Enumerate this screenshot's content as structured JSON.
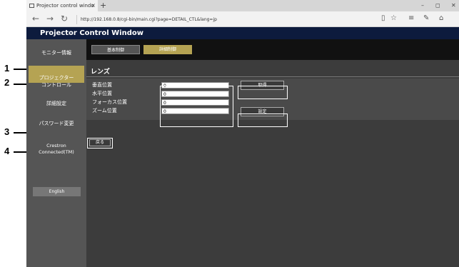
{
  "browser": {
    "tab_title": "Projector control windo",
    "tab_close": "×",
    "new_tab": "+",
    "url": "http://192.168.0.8/cgi-bin/main.cgi?page=DETAIL_CTL&lang=jp",
    "nav": {
      "back": "←",
      "forward": "→",
      "refresh": "↻"
    },
    "tools": {
      "reading": "▯",
      "favorite": "☆",
      "hub": "≡",
      "notes": "✎",
      "share": "⌂"
    },
    "window": {
      "minimize": "–",
      "maximize": "◻",
      "close": "✕"
    }
  },
  "app": {
    "title": "Projector Control Window"
  },
  "sidebar": {
    "items": [
      {
        "label": "モニター情報"
      },
      {
        "label": "プロジェクター\nコントロール"
      },
      {
        "label": "詳細設定"
      },
      {
        "label": "パスワード変更"
      },
      {
        "label": "Crestron\nConnected(TM)"
      }
    ],
    "english_label": "English"
  },
  "top_tabs": [
    {
      "label": "基本制御"
    },
    {
      "label": "詳細制御"
    }
  ],
  "section": {
    "title": "レンズ",
    "rows": [
      {
        "label": "垂直位置",
        "value": "0"
      },
      {
        "label": "水平位置",
        "value": "0"
      },
      {
        "label": "フォーカス位置",
        "value": "0"
      },
      {
        "label": "ズーム位置",
        "value": "0"
      }
    ],
    "get_button": "取得",
    "set_button": "設定",
    "back_button": "戻る"
  },
  "callouts": [
    "1",
    "2",
    "3",
    "4"
  ],
  "colors": {
    "header_bg": "#0d1b3d",
    "active_tab": "#b5a353",
    "sidebar_active": "#b5a353"
  }
}
